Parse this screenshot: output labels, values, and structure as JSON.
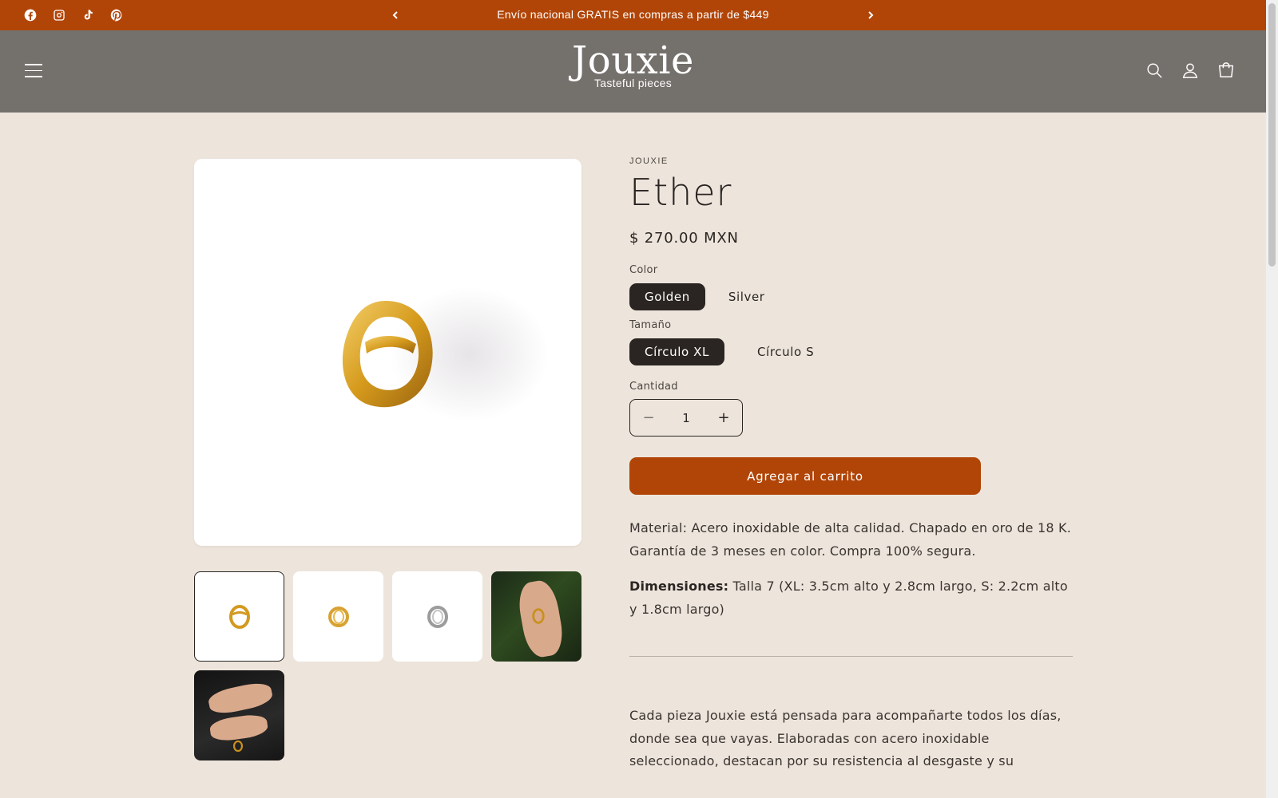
{
  "announcement": {
    "text": "Envío nacional GRATIS en compras a partir de $449",
    "social_icons": [
      "facebook-icon",
      "instagram-icon",
      "tiktok-icon",
      "pinterest-icon"
    ]
  },
  "header": {
    "logo_word": "Jouxie",
    "logo_tagline": "Tasteful pieces",
    "icons": [
      "search-icon",
      "account-icon",
      "cart-icon"
    ]
  },
  "product": {
    "vendor": "JOUXIE",
    "title": "Ether",
    "price": "$ 270.00 MXN",
    "color_label": "Color",
    "color_options": [
      "Golden",
      "Silver"
    ],
    "color_selected": "Golden",
    "size_label": "Tamaño",
    "size_options": [
      "Círculo XL",
      "Círculo S"
    ],
    "size_selected": "Círculo XL",
    "quantity_label": "Cantidad",
    "quantity": "1",
    "add_to_cart": "Agregar al carrito",
    "material_text": "Material: Acero inoxidable de alta calidad. Chapado en oro de 18 K. Garantía de 3 meses en color. Compra 100% segura.",
    "dimensions_label": "Dimensiones:",
    "dimensions_text": " Talla 7 (XL: 3.5cm alto y 2.8cm largo, S: 2.2cm alto y 1.8cm largo)",
    "long_description": "Cada pieza Jouxie está pensada para acompañarte todos los días, donde sea que vayas. Elaboradas con acero inoxidable seleccionado, destacan por su resistencia al desgaste y su"
  },
  "gallery": {
    "thumbnails": [
      "golden ring",
      "golden ring",
      "silver ring",
      "ring on hand",
      "rings on hands"
    ]
  },
  "colors": {
    "accent": "#b14507",
    "header_bg": "#74706c",
    "page_bg": "#ede5dc",
    "pill_selected": "#2a2522",
    "gold": "#d9a12a"
  }
}
